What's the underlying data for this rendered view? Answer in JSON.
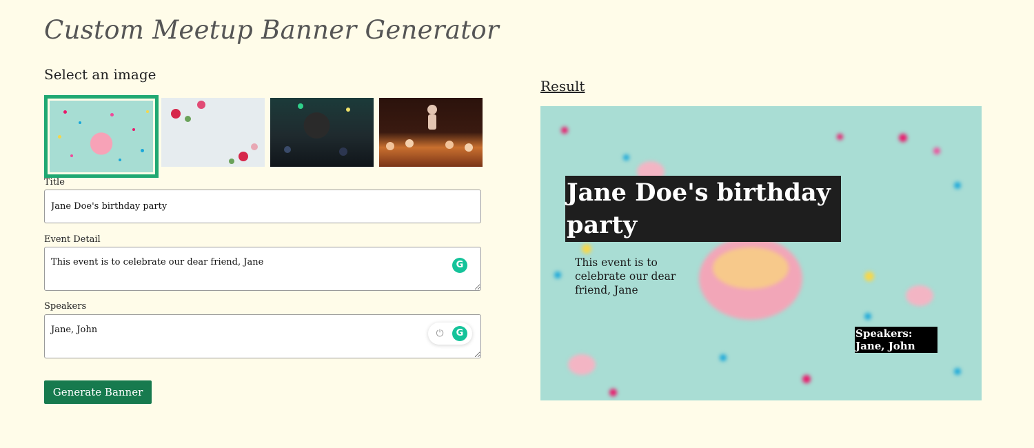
{
  "page": {
    "title": "Custom Meetup Banner Generator",
    "select_heading": "Select an image"
  },
  "images": [
    {
      "name": "birthday-party",
      "selected": true
    },
    {
      "name": "flowers",
      "selected": false
    },
    {
      "name": "microphone-concert",
      "selected": false
    },
    {
      "name": "crowd-performer",
      "selected": false
    }
  ],
  "form": {
    "title_label": "Title",
    "title_value": "Jane Doe's birthday party",
    "detail_label": "Event Detail",
    "detail_value": "This event is to celebrate our dear friend, Jane",
    "speakers_label": "Speakers",
    "speakers_value": "Jane, John",
    "generate_label": "Generate Banner"
  },
  "result": {
    "heading": "Result",
    "banner_title": "Jane Doe's birthday party",
    "banner_detail": "This event is to celebrate our dear friend, Jane",
    "speakers_prefix": "Speakers:",
    "speakers_names": "Jane, John"
  },
  "icons": {
    "grammarly_glyph": "G",
    "power_glyph": "⏻"
  },
  "colors": {
    "page_bg": "#fffce9",
    "accent_selected": "#1fa872",
    "button_bg": "#177a4e",
    "grammarly": "#15c39a",
    "banner_title_bg": "#1e1e1e"
  }
}
